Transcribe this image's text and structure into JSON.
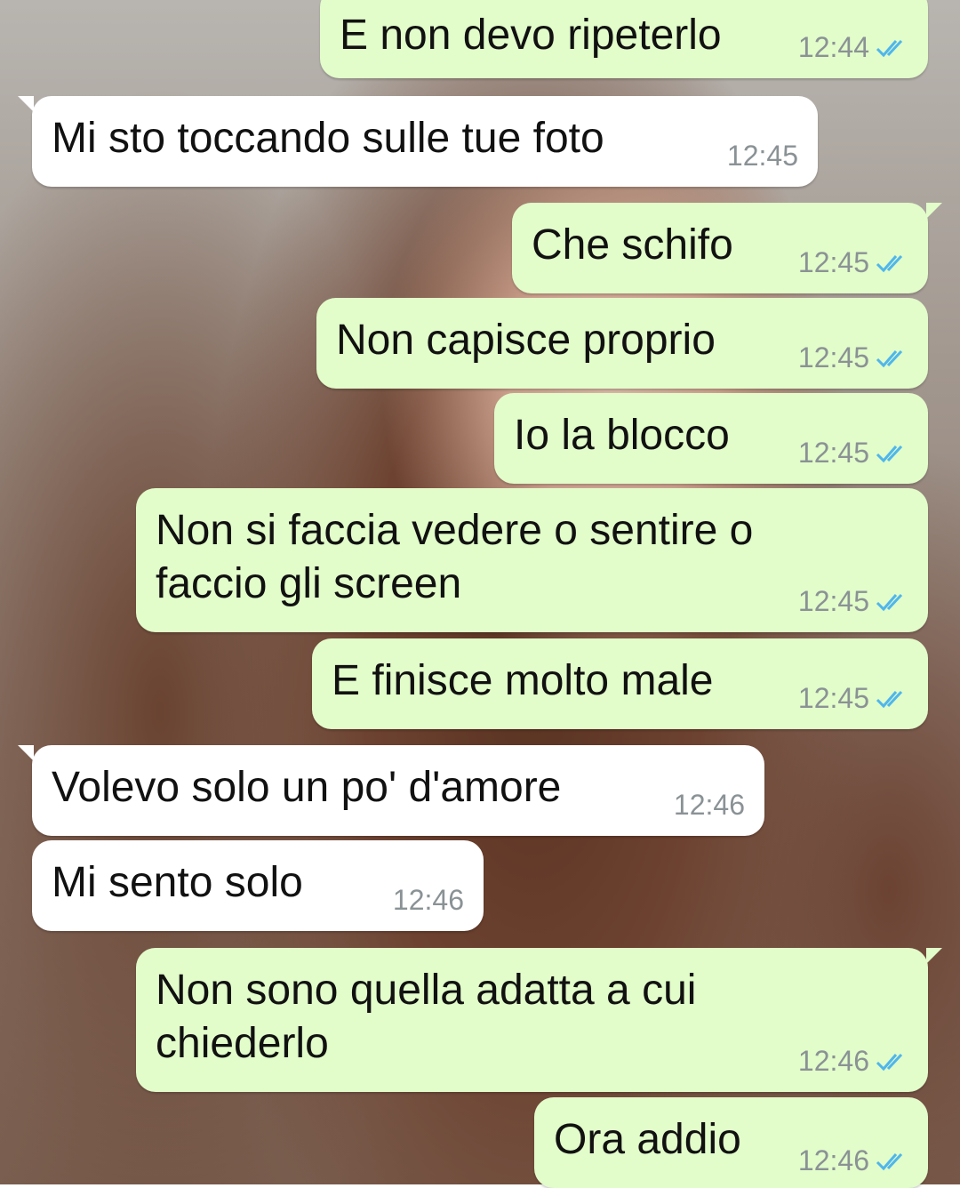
{
  "messages": [
    {
      "text": "E non devo ripeterlo",
      "time": "12:44",
      "dir": "out",
      "read_icon": "double-check-read-icon"
    },
    {
      "text": "Mi sto toccando sulle tue foto",
      "time": "12:45",
      "dir": "in"
    },
    {
      "text": "Che schifo",
      "time": "12:45",
      "dir": "out",
      "read_icon": "double-check-read-icon"
    },
    {
      "text": "Non capisce proprio",
      "time": "12:45",
      "dir": "out",
      "read_icon": "double-check-read-icon"
    },
    {
      "text": "Io la blocco",
      "time": "12:45",
      "dir": "out",
      "read_icon": "double-check-read-icon"
    },
    {
      "text": "Non si faccia vedere o sentire o\nfaccio gli screen",
      "line1": "Non si faccia vedere o sentire o",
      "line2": "faccio gli screen",
      "time": "12:45",
      "dir": "out",
      "read_icon": "double-check-read-icon"
    },
    {
      "text": "E finisce molto male",
      "time": "12:45",
      "dir": "out",
      "read_icon": "double-check-read-icon"
    },
    {
      "text": "Volevo solo un po' d'amore",
      "time": "12:46",
      "dir": "in"
    },
    {
      "text": "Mi sento solo",
      "time": "12:46",
      "dir": "in"
    },
    {
      "text": "Non sono quella adatta a cui\nchiederlo",
      "line1": "Non sono quella adatta a cui",
      "line2": "chiederlo",
      "time": "12:46",
      "dir": "out",
      "read_icon": "double-check-read-icon"
    },
    {
      "text": "Ora addio",
      "time": "12:46",
      "dir": "out",
      "read_icon": "double-check-read-icon"
    }
  ],
  "colors": {
    "outgoing_bubble": "#e2fcca",
    "incoming_bubble": "#ffffff",
    "read_ticks": "#4fb6ec",
    "timestamp": "#8a9295"
  }
}
